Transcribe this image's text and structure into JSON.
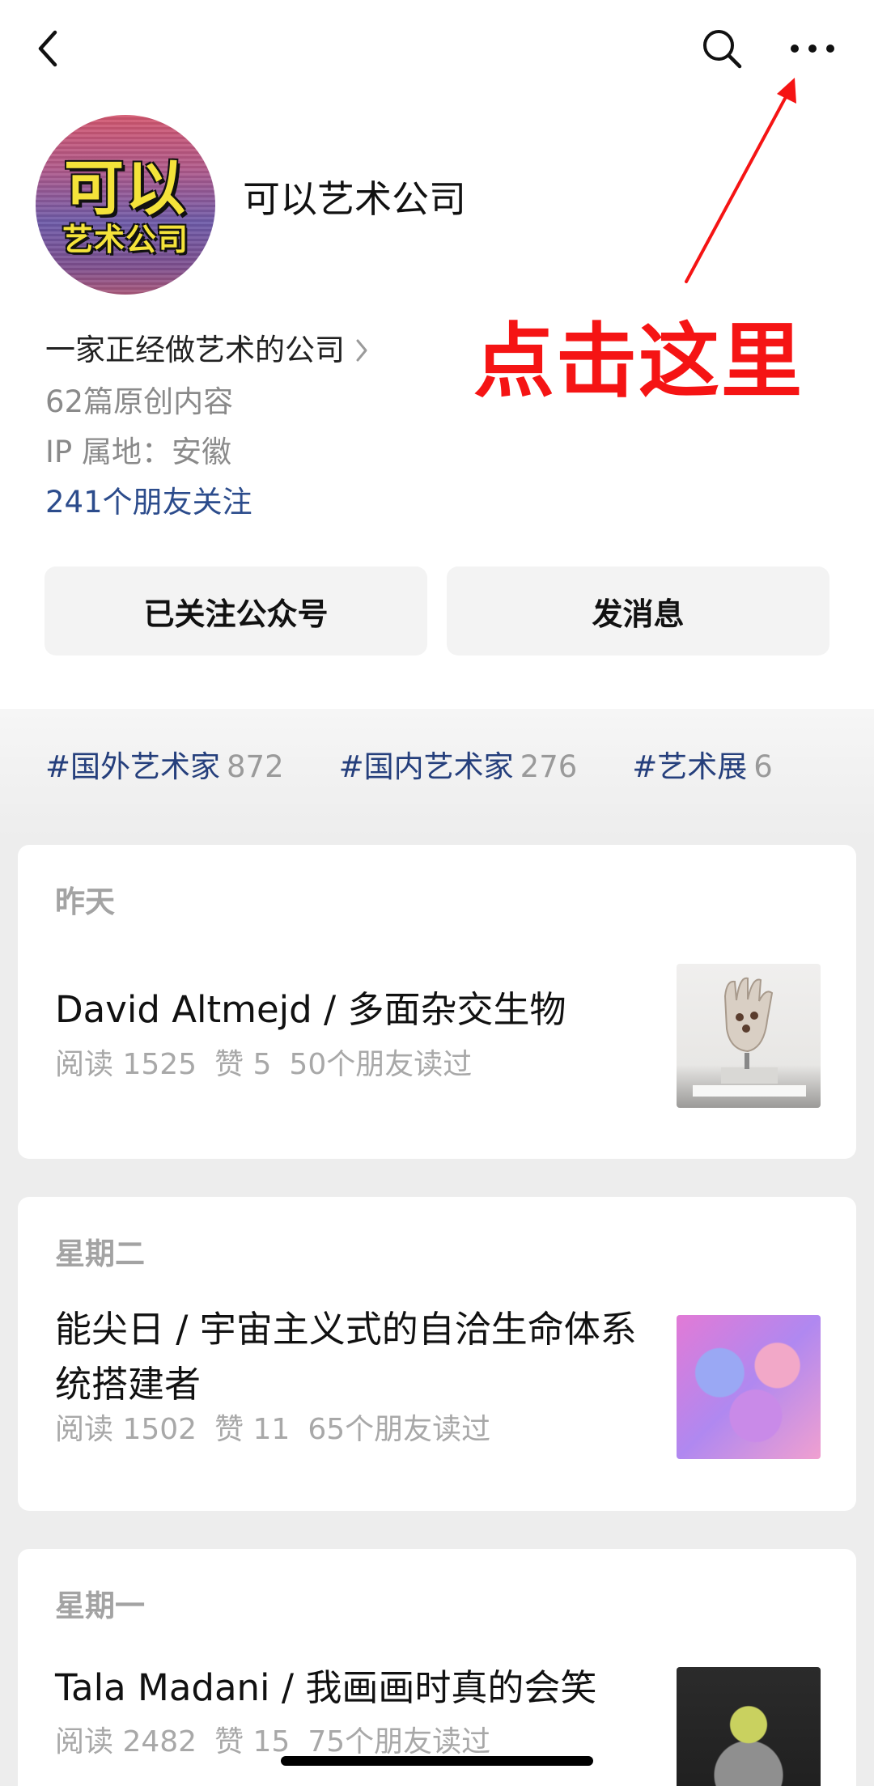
{
  "header": {
    "back_icon": "chevron-left-icon",
    "search_icon": "search-icon",
    "more_icon": "more-horizontal-icon"
  },
  "profile": {
    "avatar_text_line1": "可以",
    "avatar_text_line2": "艺术公司",
    "name": "可以艺术公司",
    "bio": "一家正经做艺术的公司",
    "articles": "62篇原创内容",
    "ip_location": "IP 属地：安徽",
    "friends_following": "241个朋友关注"
  },
  "annotation": {
    "text": "点击这里",
    "color": "#f51414"
  },
  "actions": {
    "followed_label": "已关注公众号",
    "message_label": "发消息"
  },
  "tags": [
    {
      "name": "#国外艺术家",
      "count": "872"
    },
    {
      "name": "#国内艺术家",
      "count": "276"
    },
    {
      "name": "#艺术展",
      "count": "6"
    }
  ],
  "articles": [
    {
      "date": "昨天",
      "title": "David Altmejd / 多面杂交生物",
      "reads": "阅读 1525",
      "likes": "赞 5",
      "friends_read": "50个朋友读过"
    },
    {
      "date": "星期二",
      "title": "能尖日 / 宇宙主义式的自洽生命体系统搭建者",
      "reads": "阅读 1502",
      "likes": "赞 11",
      "friends_read": "65个朋友读过"
    },
    {
      "date": "星期一",
      "title": "Tala Madani / 我画画时真的会笑",
      "reads": "阅读 2482",
      "likes": "赞 15",
      "friends_read": "75个朋友读过"
    }
  ],
  "colors": {
    "link_blue": "#2c4c8c",
    "tag_blue": "#253f7c",
    "avatar_yellow": "#f4e33a"
  }
}
